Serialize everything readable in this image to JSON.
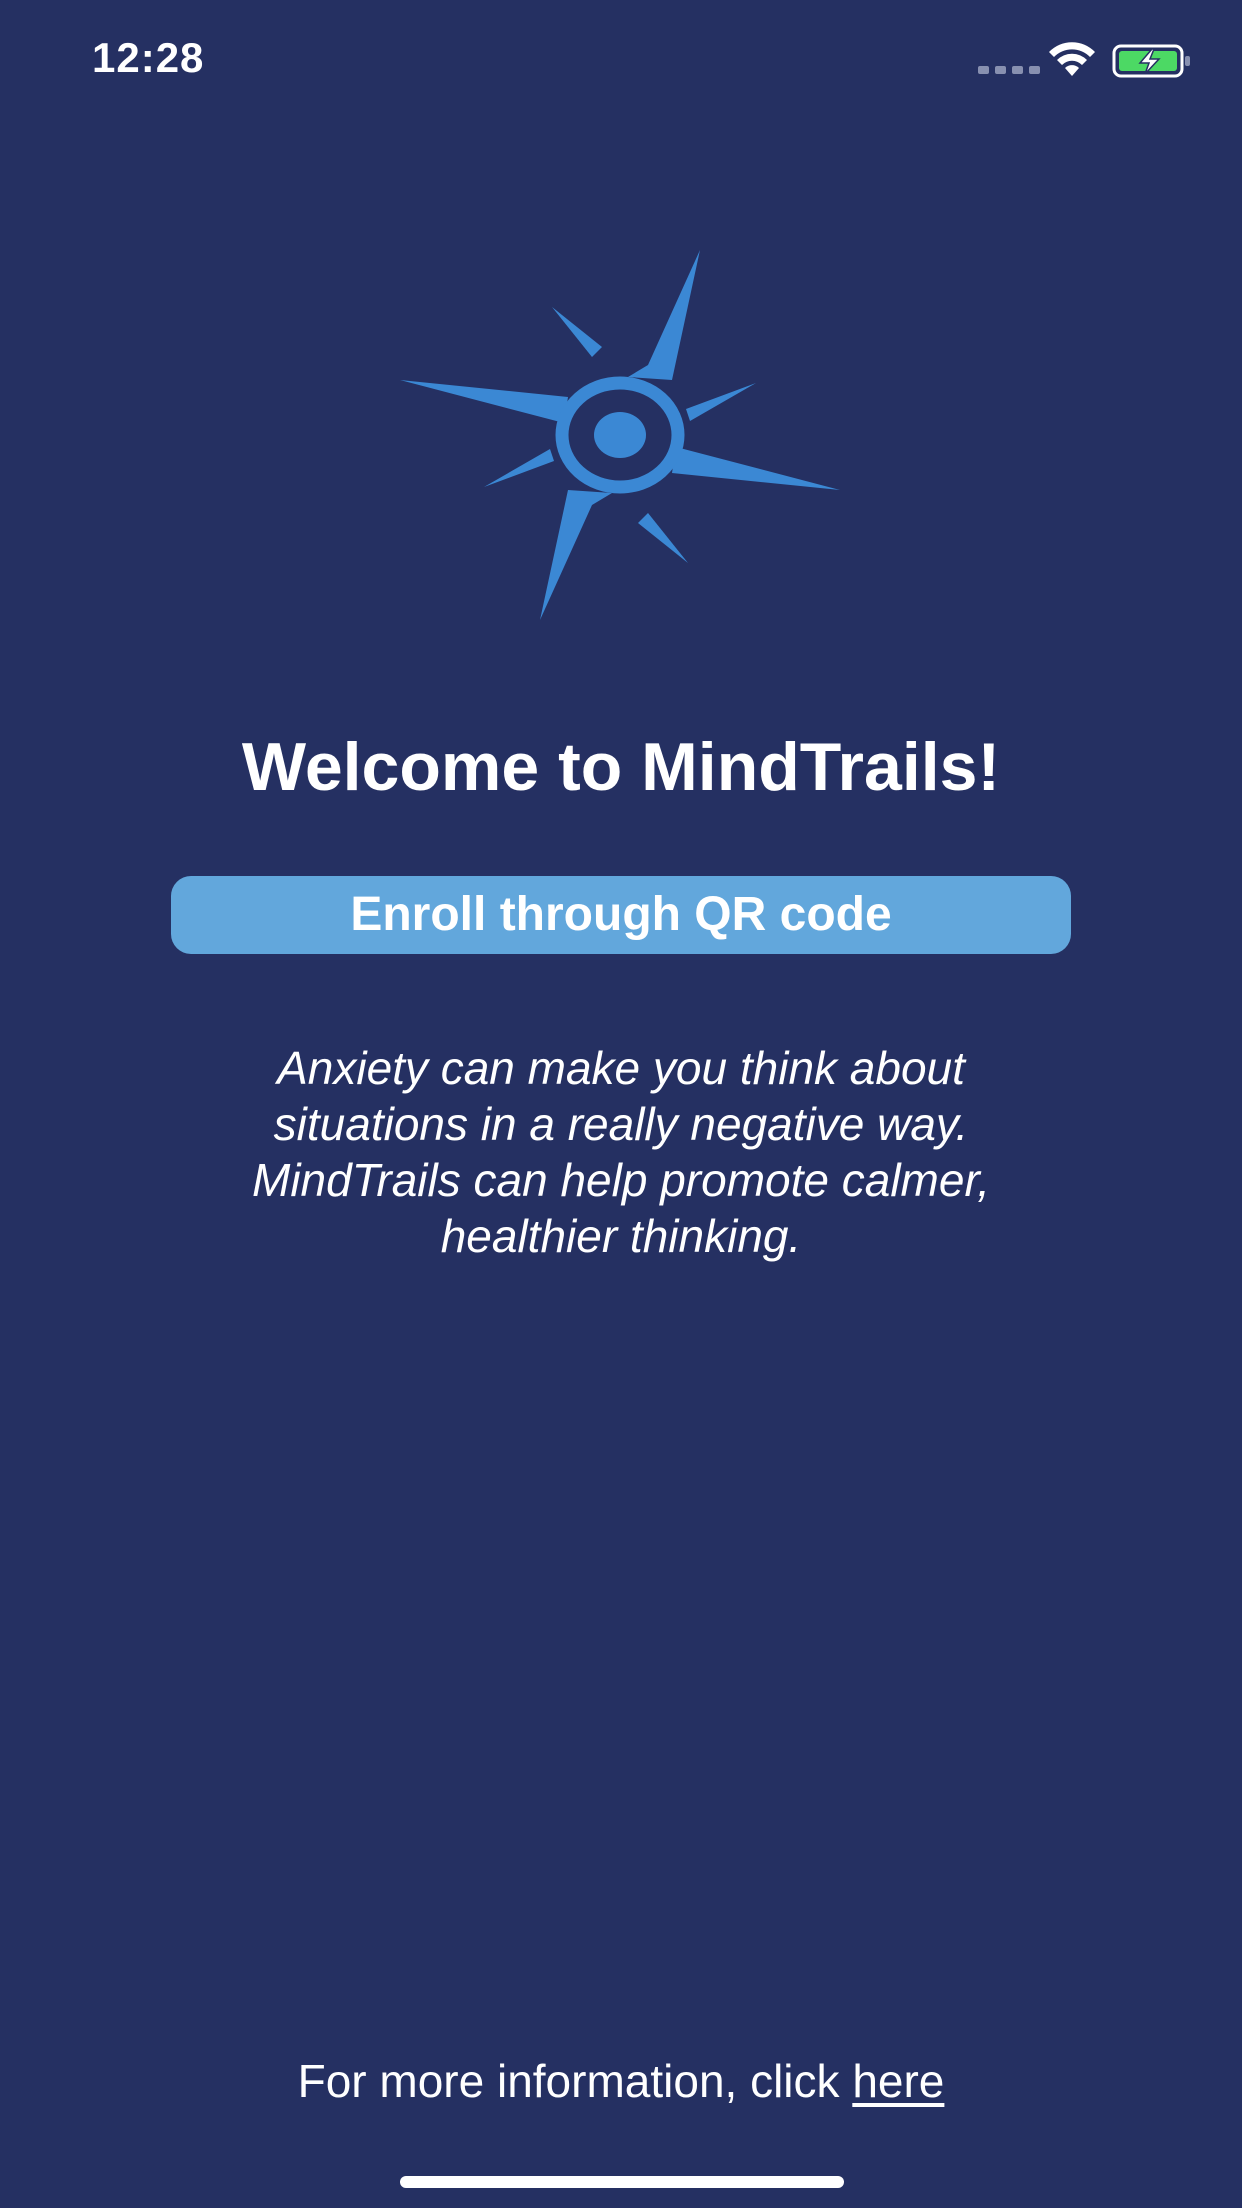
{
  "status_bar": {
    "time": "12:28",
    "icons": [
      "cellular-signal-icon",
      "wifi-icon",
      "battery-charging-icon"
    ]
  },
  "logo": {
    "icon": "compass-star-logo",
    "color": "#3b88d4"
  },
  "welcome": {
    "title": "Welcome to MindTrails!"
  },
  "enroll": {
    "label": "Enroll through QR code"
  },
  "description": {
    "lines": [
      "Anxiety can make you think about",
      "situations in a really negative way.",
      "MindTrails can help promote calmer,",
      "healthier thinking."
    ]
  },
  "footer": {
    "prefix": "For more information, click ",
    "link_label": "here"
  },
  "colors": {
    "background": "#253062",
    "button": "#62a7dc",
    "logo": "#3b88d4",
    "battery_fill": "#4cd964"
  }
}
